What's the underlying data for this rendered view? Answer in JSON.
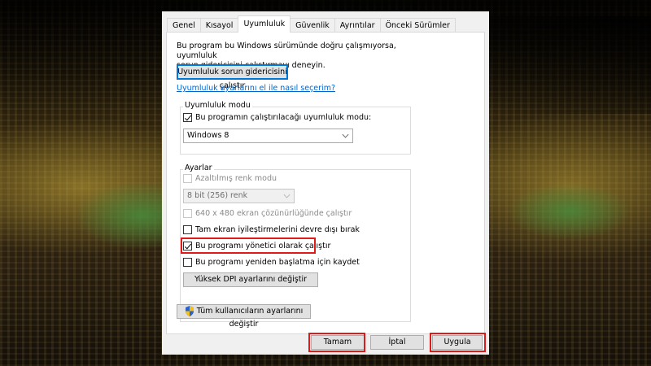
{
  "tabs": [
    {
      "label": "Genel",
      "active": false
    },
    {
      "label": "Kısayol",
      "active": false
    },
    {
      "label": "Uyumluluk",
      "active": true
    },
    {
      "label": "Güvenlik",
      "active": false
    },
    {
      "label": "Ayrıntılar",
      "active": false
    },
    {
      "label": "Önceki Sürümler",
      "active": false
    }
  ],
  "intro": {
    "line1": "Bu program bu Windows sürümünde doğru çalışmıyorsa, uyumluluk",
    "line2": "sorun gidericisini çalıştırmayı deneyin."
  },
  "troubleshooter_button": "Uyumluluk sorun gidericisini çalıştır",
  "manual_link": "Uyumluluk ayarlarını el ile nasıl seçerim?",
  "compat_mode": {
    "title": "Uyumluluk modu",
    "checkbox_label": "Bu programın çalıştırılacağı uyumluluk modu:",
    "checked": true,
    "selected_os": "Windows 8"
  },
  "settings": {
    "title": "Ayarlar",
    "reduced_color": "Azaltılmış renk modu",
    "color_select": "8 bit (256) renk",
    "resolution_640": "640 x 480 ekran çözünürlüğünde çalıştır",
    "fullscreen_opt": "Tam ekran iyileştirmelerini devre dışı bırak",
    "run_as_admin": "Bu programı yönetici olarak çalıştır",
    "run_as_admin_checked": true,
    "register_restart": "Bu programı yeniden başlatma için kaydet",
    "dpi_button": "Yüksek DPI ayarlarını değiştir"
  },
  "all_users_button": "Tüm kullanıcıların ayarlarını değiştir",
  "footer": {
    "ok": "Tamam",
    "cancel": "İptal",
    "apply": "Uygula"
  },
  "colors": {
    "highlight": "#e01919",
    "link": "#0066cc",
    "focus_border": "#0078d7"
  }
}
